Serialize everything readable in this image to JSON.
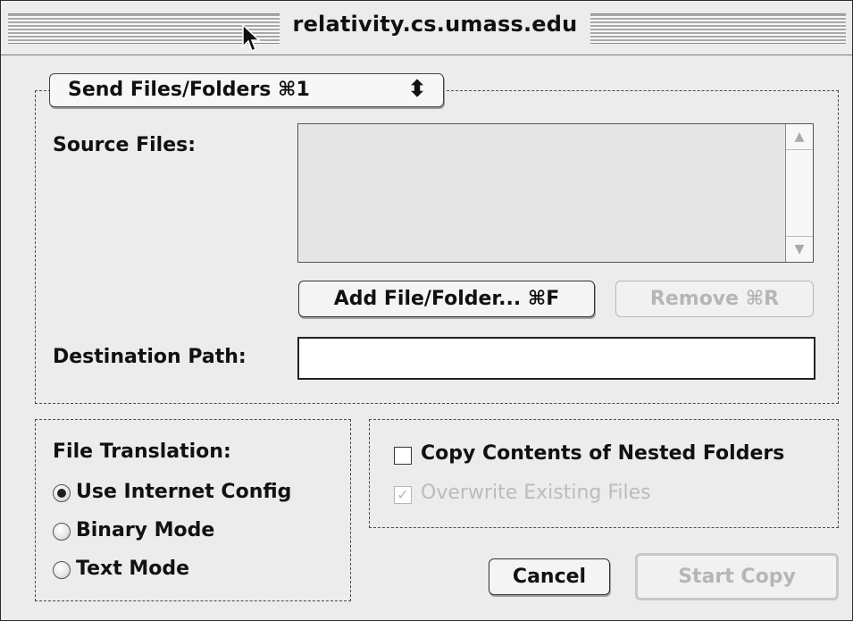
{
  "window": {
    "title": "relativity.cs.umass.edu"
  },
  "mode_popup": {
    "value": "Send Files/Folders ⌘1",
    "arrows": "⬍"
  },
  "source": {
    "label": "Source Files:",
    "scroll_up": "▲",
    "scroll_down": "▼"
  },
  "buttons": {
    "add": "Add File/Folder... ⌘F",
    "remove": "Remove ⌘R",
    "cancel": "Cancel",
    "start": "Start Copy"
  },
  "destination": {
    "label": "Destination Path:",
    "value": ""
  },
  "translation": {
    "label": "File Translation:",
    "options": [
      "Use Internet Config",
      "Binary Mode",
      "Text Mode"
    ],
    "selected": "Use Internet Config"
  },
  "options": {
    "nested": {
      "label": "Copy Contents of Nested Folders",
      "checked": false
    },
    "overwrite": {
      "label": "Overwrite Existing Files",
      "checked": true,
      "disabled": true,
      "check_glyph": "✓"
    }
  }
}
